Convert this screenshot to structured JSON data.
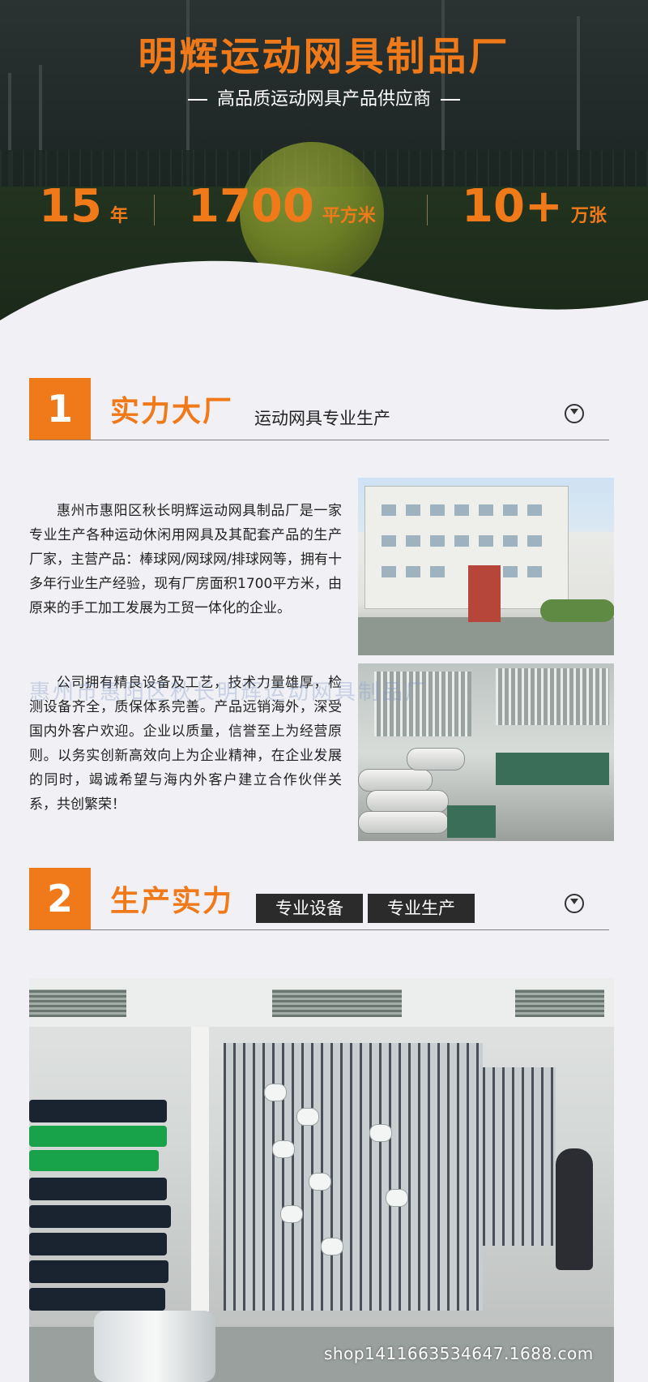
{
  "hero": {
    "title": "明辉运动网具制品厂",
    "subtitle": "高品质运动网具产品供应商",
    "stats": [
      {
        "number": "15",
        "unit": "年"
      },
      {
        "number": "1700",
        "unit": "平方米"
      },
      {
        "number": "10+",
        "unit": "万张"
      }
    ]
  },
  "section1": {
    "number": "1",
    "title": "实力大厂",
    "subtitle": "运动网具专业生产",
    "icon": "chevron-down-circle-icon",
    "paragraph1": "惠州市惠阳区秋长明辉运动网具制品厂是一家专业生产各种运动休闲用网具及其配套产品的生产厂家，主营产品：棒球网/网球网/排球网等，拥有十多年行业生产经验，现有厂房面积1700平方米，由原来的手工加工发展为工贸一体化的企业。",
    "paragraph2": "公司拥有精良设备及工艺，技术力量雄厚，检测设备齐全，质保体系完善。产品远销海外，深受国内外客户欢迎。企业以质量，信誉至上为经营原则。以务实创新高效向上为企业精神，在企业发展的同时，竭诚希望与海内外客户建立合作伙伴关系，共创繁荣！"
  },
  "section2": {
    "number": "2",
    "title": "生产实力",
    "tags": [
      "专业设备",
      "专业生产"
    ],
    "icon": "chevron-down-circle-icon"
  },
  "watermark": "shop1411663534647.1688.com",
  "ghost_watermark": "惠州市惠阳区秋长明辉运动网具制品厂",
  "colors": {
    "accent": "#f07a1a",
    "dark": "#2b2b2b",
    "background": "#f1f0f4"
  }
}
